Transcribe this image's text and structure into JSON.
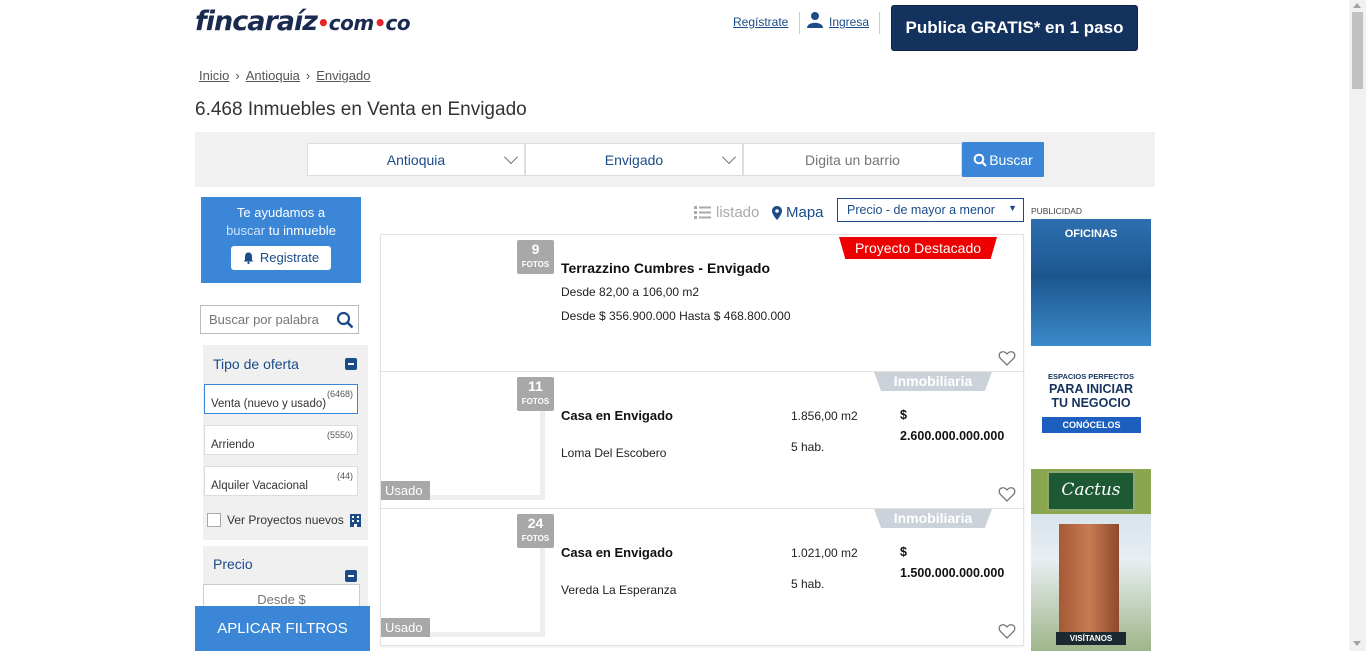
{
  "header": {
    "logo_main": "fincaraíz",
    "logo_com": "com",
    "logo_co": "co",
    "register_link": "Regístrate",
    "login_link": "Ingresa",
    "publish_button": "Publica GRATIS* en 1 paso"
  },
  "breadcrumb": [
    "Inicio",
    "Antioquia",
    "Envigado"
  ],
  "page_title": "6.468 Inmuebles en Venta en Envigado",
  "search": {
    "department": "Antioquia",
    "city": "Envigado",
    "neighborhood_placeholder": "Digita un barrio",
    "button": "Buscar"
  },
  "sidebar": {
    "help_line1": "Te ayudamos a",
    "help_highlight": "buscar",
    "help_line2": "tu inmueble",
    "help_button": "Registrate",
    "keyword_placeholder": "Buscar por palabra",
    "offer_title": "Tipo de oferta",
    "offer_options": [
      {
        "label": "Venta (nuevo y usado)",
        "count": "(6468)"
      },
      {
        "label": "Arriendo",
        "count": "(5550)"
      },
      {
        "label": "Alquiler Vacacional",
        "count": "(44)"
      }
    ],
    "projects_checkbox": "Ver Proyectos nuevos",
    "price_title": "Precio",
    "price_from_placeholder": "Desde $",
    "apply_button": "APLICAR FILTROS"
  },
  "results": {
    "view_list": "listado",
    "view_map": "Mapa",
    "sort": "Precio - de mayor a menor",
    "listings": [
      {
        "photos": "9",
        "photos_label": "FOTOS",
        "ribbon": "Proyecto Destacado",
        "title": "Terrazzino Cumbres - Envigado",
        "area_range": "Desde 82,00 a 106,00 m2",
        "price_range": "Desde $ 356.900.000 Hasta $ 468.800.000"
      },
      {
        "photos": "11",
        "photos_label": "FOTOS",
        "ribbon": "Inmobiliaria",
        "condition": "Usado",
        "title": "Casa en Envigado",
        "location": "Loma Del Escobero",
        "area": "1.856,00 m2",
        "rooms": "5 hab.",
        "price_symbol": "$",
        "price": "2.600.000.000.000"
      },
      {
        "photos": "24",
        "photos_label": "FOTOS",
        "ribbon": "Inmobiliaria",
        "condition": "Usado",
        "title": "Casa en Envigado",
        "location": "Vereda La Esperanza",
        "area": "1.021,00 m2",
        "rooms": "5 hab.",
        "price_symbol": "$",
        "price": "1.500.000.000.000"
      }
    ]
  },
  "ads": {
    "label": "PUBLICIDAD",
    "offices_title": "OFICINAS",
    "text_line1": "ESPACIOS PERFECTOS",
    "text_line2": "PARA INICIAR",
    "text_line3": "TU NEGOCIO",
    "cta": "CONÓCELOS",
    "cactus_logo": "Cactus",
    "cactus_cta": "VISÍTANOS"
  },
  "colors": {
    "brand_navy": "#14325e",
    "accent_blue": "#3b86d6",
    "link_blue": "#1b4c89",
    "featured_red": "#e00000"
  }
}
